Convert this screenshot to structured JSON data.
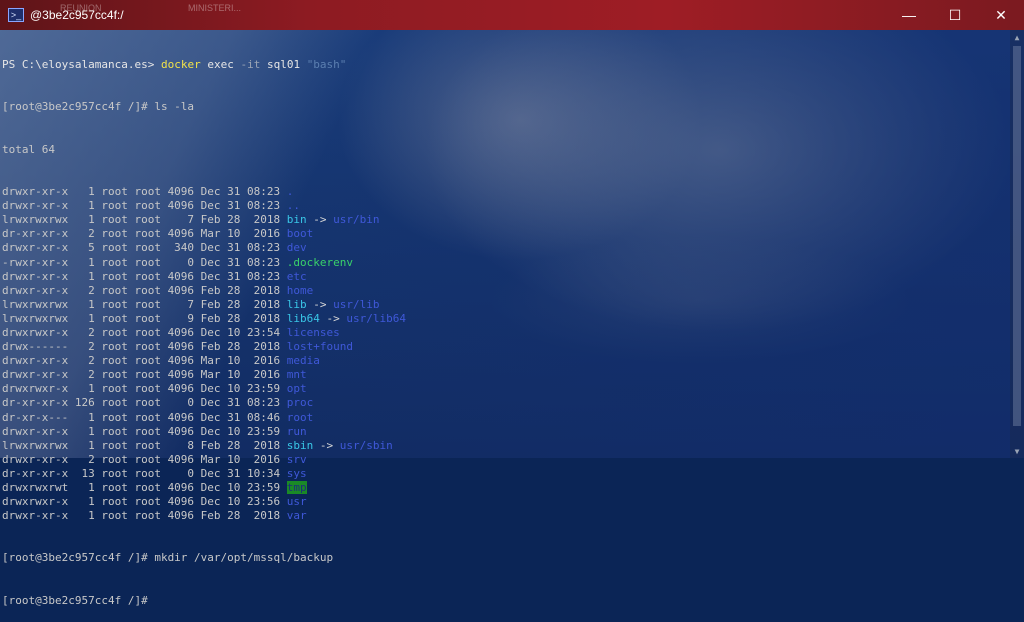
{
  "window": {
    "title": "@3be2c957cc4f:/",
    "background_tab_1": "REUNION",
    "background_tab_2": "MINISTERI...",
    "minimize_glyph": "—",
    "maximize_glyph": "☐",
    "close_glyph": "✕",
    "app_icon_glyph": ">_"
  },
  "terminal": {
    "ps_prompt": "PS C:\\eloysalamanca.es> ",
    "ps_cmd_docker": "docker",
    "ps_cmd_exec": " exec ",
    "ps_cmd_flag": "-it",
    "ps_cmd_container": " sql01 ",
    "ps_cmd_bash": "\"bash\"",
    "prompt_ls": "[root@3be2c957cc4f /]# ls -la",
    "total": "total 64",
    "listing": [
      {
        "meta": "drwxr-xr-x   1 root root 4096 Dec 31 08:23 ",
        "name": ".",
        "cls": "blue",
        "link": "",
        "target": ""
      },
      {
        "meta": "drwxr-xr-x   1 root root 4096 Dec 31 08:23 ",
        "name": "..",
        "cls": "blue",
        "link": "",
        "target": ""
      },
      {
        "meta": "lrwxrwxrwx   1 root root    7 Feb 28  2018 ",
        "name": "bin",
        "cls": "cyan",
        "link": " -> ",
        "target": "usr/bin"
      },
      {
        "meta": "dr-xr-xr-x   2 root root 4096 Mar 10  2016 ",
        "name": "boot",
        "cls": "blue",
        "link": "",
        "target": ""
      },
      {
        "meta": "drwxr-xr-x   5 root root  340 Dec 31 08:23 ",
        "name": "dev",
        "cls": "blue",
        "link": "",
        "target": ""
      },
      {
        "meta": "-rwxr-xr-x   1 root root    0 Dec 31 08:23 ",
        "name": ".dockerenv",
        "cls": "green",
        "link": "",
        "target": ""
      },
      {
        "meta": "drwxr-xr-x   1 root root 4096 Dec 31 08:23 ",
        "name": "etc",
        "cls": "blue",
        "link": "",
        "target": ""
      },
      {
        "meta": "drwxr-xr-x   2 root root 4096 Feb 28  2018 ",
        "name": "home",
        "cls": "blue",
        "link": "",
        "target": ""
      },
      {
        "meta": "lrwxrwxrwx   1 root root    7 Feb 28  2018 ",
        "name": "lib",
        "cls": "cyan",
        "link": " -> ",
        "target": "usr/lib"
      },
      {
        "meta": "lrwxrwxrwx   1 root root    9 Feb 28  2018 ",
        "name": "lib64",
        "cls": "cyan",
        "link": " -> ",
        "target": "usr/lib64"
      },
      {
        "meta": "drwxrwxr-x   2 root root 4096 Dec 10 23:54 ",
        "name": "licenses",
        "cls": "blue",
        "link": "",
        "target": ""
      },
      {
        "meta": "drwx------   2 root root 4096 Feb 28  2018 ",
        "name": "lost+found",
        "cls": "blue",
        "link": "",
        "target": ""
      },
      {
        "meta": "drwxr-xr-x   2 root root 4096 Mar 10  2016 ",
        "name": "media",
        "cls": "blue",
        "link": "",
        "target": ""
      },
      {
        "meta": "drwxr-xr-x   2 root root 4096 Mar 10  2016 ",
        "name": "mnt",
        "cls": "blue",
        "link": "",
        "target": ""
      },
      {
        "meta": "drwxrwxr-x   1 root root 4096 Dec 10 23:59 ",
        "name": "opt",
        "cls": "blue",
        "link": "",
        "target": ""
      },
      {
        "meta": "dr-xr-xr-x 126 root root    0 Dec 31 08:23 ",
        "name": "proc",
        "cls": "blue",
        "link": "",
        "target": ""
      },
      {
        "meta": "dr-xr-x---   1 root root 4096 Dec 31 08:46 ",
        "name": "root",
        "cls": "blue",
        "link": "",
        "target": ""
      },
      {
        "meta": "drwxr-xr-x   1 root root 4096 Dec 10 23:59 ",
        "name": "run",
        "cls": "blue",
        "link": "",
        "target": ""
      },
      {
        "meta": "lrwxrwxrwx   1 root root    8 Feb 28  2018 ",
        "name": "sbin",
        "cls": "cyan",
        "link": " -> ",
        "target": "usr/sbin"
      },
      {
        "meta": "drwxr-xr-x   2 root root 4096 Mar 10  2016 ",
        "name": "srv",
        "cls": "blue",
        "link": "",
        "target": ""
      },
      {
        "meta": "dr-xr-xr-x  13 root root    0 Dec 31 10:34 ",
        "name": "sys",
        "cls": "blue",
        "link": "",
        "target": ""
      },
      {
        "meta": "drwxrwxrwt   1 root root 4096 Dec 10 23:59 ",
        "name": "tmp",
        "cls": "tmp",
        "link": "",
        "target": ""
      },
      {
        "meta": "drwxrwxr-x   1 root root 4096 Dec 10 23:56 ",
        "name": "usr",
        "cls": "blue",
        "link": "",
        "target": ""
      },
      {
        "meta": "drwxr-xr-x   1 root root 4096 Feb 28  2018 ",
        "name": "var",
        "cls": "blue",
        "link": "",
        "target": ""
      }
    ],
    "prompt_mkdir": "[root@3be2c957cc4f /]# mkdir /var/opt/mssql/backup",
    "prompt_last": "[root@3be2c957cc4f /]# "
  },
  "scrollbar": {
    "up_glyph": "▲",
    "down_glyph": "▼"
  },
  "colors": {
    "titlebar": "#8d1b22",
    "dir": "#3f58d8",
    "symlink": "#39c6e6",
    "executable": "#39d16a",
    "sticky_bg": "#1a8a26"
  }
}
